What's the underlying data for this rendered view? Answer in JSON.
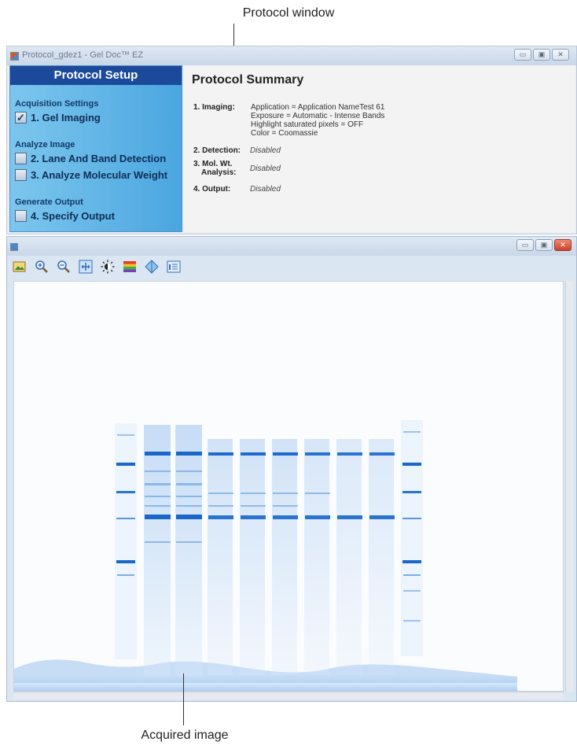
{
  "callouts": {
    "top": "Protocol window",
    "bottom": "Acquired image"
  },
  "protocol_window": {
    "title": "Protocol_gdez1 - Gel Doc™ EZ",
    "window_buttons": [
      "minimize",
      "maximize",
      "close"
    ],
    "setup": {
      "header": "Protocol Setup",
      "sections": {
        "acquisition": "Acquisition Settings",
        "analyze": "Analyze Image",
        "generate": "Generate Output"
      },
      "steps": [
        {
          "label": "1. Gel Imaging",
          "checked": true
        },
        {
          "label": "2. Lane And Band Detection",
          "checked": false
        },
        {
          "label": "3. Analyze Molecular Weight",
          "checked": false
        },
        {
          "label": "4. Specify Output",
          "checked": false
        }
      ],
      "check_mark": "✓"
    },
    "summary": {
      "title": "Protocol Summary",
      "imaging_key": "1. Imaging:",
      "imaging_lines": [
        "Application = Application NameTest 61",
        "Exposure = Automatic - Intense Bands",
        "Highlight saturated pixels = OFF",
        "Color = Coomassie"
      ],
      "detection_key": "2. Detection:",
      "detection_val": "Disabled",
      "molwt_key_1": "3. Mol. Wt.",
      "molwt_key_2": "Analysis:",
      "molwt_val": "Disabled",
      "output_key": "4. Output:",
      "output_val": "Disabled"
    }
  },
  "image_window": {
    "toolbar_icons": [
      "image-settings-icon",
      "zoom-in-icon",
      "zoom-out-icon",
      "fit-to-window-icon",
      "brightness-icon",
      "color-palette-icon",
      "3d-view-icon",
      "info-icon"
    ],
    "gel": {
      "lanes": 10,
      "colors": {
        "band": "#1a66c9",
        "smear": "#7fb4ea",
        "background": "#ffffff"
      }
    }
  }
}
